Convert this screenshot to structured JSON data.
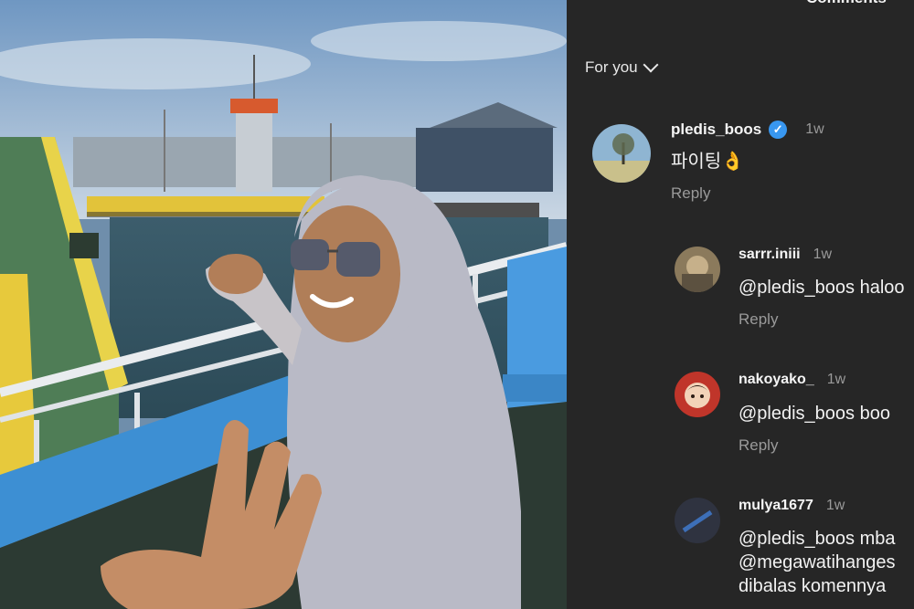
{
  "panel": {
    "title": "Comments",
    "filter_label": "For you"
  },
  "comments": [
    {
      "username": "pledis_boos",
      "time": "1w",
      "text": "파이팅",
      "emoji": "👌",
      "reply_label": "Reply"
    },
    {
      "username": "sarrr.iniii",
      "time": "1w",
      "text": "@pledis_boos haloo",
      "reply_label": "Reply"
    },
    {
      "username": "nakoyako_",
      "time": "1w",
      "text": "@pledis_boos boo",
      "reply_label": "Reply"
    },
    {
      "username": "mulya1677",
      "time": "1w",
      "text_lines": [
        "@pledis_boos mba",
        "@megawatihanges",
        "dibalas komennya"
      ]
    }
  ],
  "colors": {
    "panel_bg": "#262626",
    "verified_blue": "#3897f0",
    "muted": "#9a9a9a"
  }
}
